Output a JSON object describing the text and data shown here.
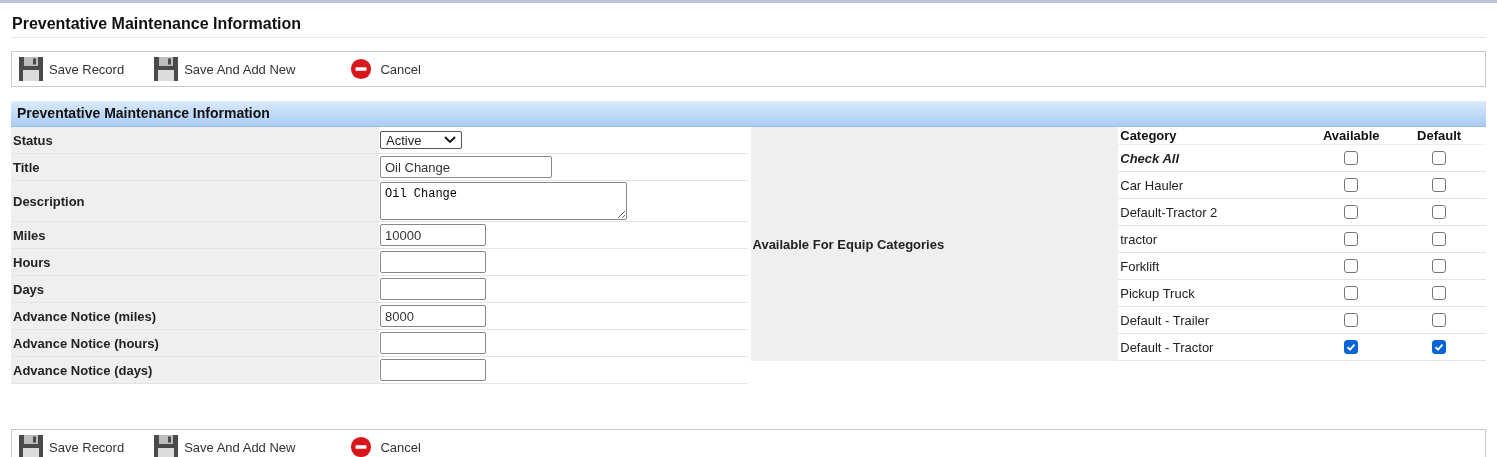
{
  "page_title": "Preventative Maintenance Information",
  "toolbar_top": [
    {
      "kind": "save",
      "label": "Save Record"
    },
    {
      "kind": "save",
      "label": "Save And Add New"
    },
    {
      "kind": "cancel",
      "label": "Cancel"
    }
  ],
  "section": {
    "title": "Preventative Maintenance Information",
    "fields": [
      {
        "label": "Status",
        "kind": "select",
        "value": "Active"
      },
      {
        "label": "Title",
        "kind": "wide_text",
        "value": "Oil Change"
      },
      {
        "label": "Description",
        "kind": "textarea",
        "value": "Oil Change"
      },
      {
        "label": "Miles",
        "kind": "text",
        "value": "10000"
      },
      {
        "label": "Hours",
        "kind": "text"
      },
      {
        "label": "Days",
        "kind": "text"
      },
      {
        "label": "Advance Notice (miles)",
        "kind": "text",
        "value": "8000"
      },
      {
        "label": "Advance Notice (hours)",
        "kind": "text"
      },
      {
        "label": "Advance Notice (days)",
        "kind": "text"
      }
    ],
    "categories_label": "Available For Equip Categories",
    "category_columns": [
      "Category",
      "Available",
      "Default"
    ],
    "categories": [
      {
        "kind": "check_all",
        "name": "Check All",
        "available": false,
        "default": false
      },
      {
        "kind": "item",
        "name": "Car Hauler",
        "available": false,
        "default": false
      },
      {
        "kind": "item",
        "name": "Default-Tractor 2",
        "available": false,
        "default": false
      },
      {
        "kind": "item",
        "name": "tractor",
        "available": false,
        "default": false
      },
      {
        "kind": "item",
        "name": "Forklift",
        "available": false,
        "default": false
      },
      {
        "kind": "item",
        "name": "Pickup Truck",
        "available": false,
        "default": false
      },
      {
        "kind": "item",
        "name": "Default - Trailer",
        "available": false,
        "default": false
      },
      {
        "kind": "item",
        "name": "Default - Tractor",
        "available": true,
        "default": true
      }
    ]
  },
  "toolbar_bottom": [
    {
      "kind": "save",
      "label": "Save Record"
    },
    {
      "kind": "save",
      "label": "Save And Add New"
    },
    {
      "kind": "cancel",
      "label": "Cancel"
    }
  ]
}
